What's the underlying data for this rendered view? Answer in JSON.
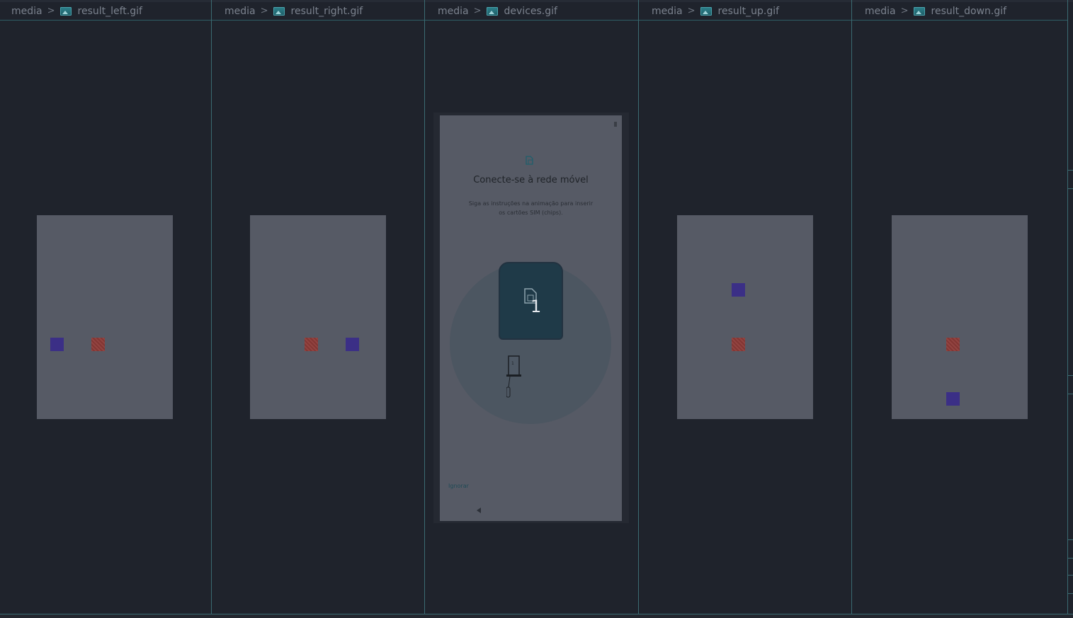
{
  "panes": [
    {
      "folder": "media",
      "file": "result_left.gif",
      "squares": [
        {
          "color": "blue"
        },
        {
          "color": "red"
        }
      ]
    },
    {
      "folder": "media",
      "file": "result_right.gif",
      "squares": [
        {
          "color": "red"
        },
        {
          "color": "blue"
        }
      ]
    },
    {
      "folder": "media",
      "file": "devices.gif"
    },
    {
      "folder": "media",
      "file": "result_up.gif",
      "squares": [
        {
          "color": "blue"
        },
        {
          "color": "red"
        }
      ]
    },
    {
      "folder": "media",
      "file": "result_down.gif",
      "squares": [
        {
          "color": "red"
        },
        {
          "color": "blue"
        }
      ]
    }
  ],
  "device_screen": {
    "title": "Conecte-se à rede móvel",
    "subtitle": "Siga as instruções na animação para inserir os cartões SIM (chips).",
    "slot_number": "1",
    "skip_label": "Ignorar",
    "tray_number": "1"
  },
  "colors": {
    "background": "#1f232c",
    "pane_border": "#3b6b72",
    "image_canvas": "#565a65",
    "blue_square": "#3b2f86",
    "red_square": "#8d3a37",
    "sim_slot": "#1f3a48"
  },
  "icons": {
    "breadcrumb_separator": "chevron-right-icon",
    "file_type": "image-file-icon",
    "sim_card": "sim-card-icon",
    "back": "back-triangle-icon"
  }
}
